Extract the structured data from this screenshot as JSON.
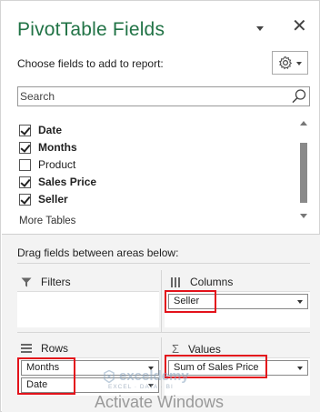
{
  "header": {
    "title": "PivotTable Fields",
    "subtitle": "Choose fields to add to report:"
  },
  "search": {
    "placeholder": "Search"
  },
  "fields": [
    {
      "label": "Date",
      "checked": true,
      "bold": true
    },
    {
      "label": "Months",
      "checked": true,
      "bold": true
    },
    {
      "label": "Product",
      "checked": false,
      "bold": false
    },
    {
      "label": "Sales Price",
      "checked": true,
      "bold": true
    },
    {
      "label": "Seller",
      "checked": true,
      "bold": true
    }
  ],
  "more_tables_label": "More Tables",
  "areas": {
    "drag_label": "Drag fields between areas below:",
    "filters": {
      "label": "Filters",
      "items": []
    },
    "columns": {
      "label": "Columns",
      "items": [
        "Seller"
      ]
    },
    "rows": {
      "label": "Rows",
      "items": [
        "Months",
        "Date"
      ]
    },
    "values": {
      "label": "Values",
      "items": [
        "Sum of Sales Price"
      ]
    }
  },
  "watermark": {
    "brand": "exceldemy",
    "tagline": "EXCEL · DATA · BI",
    "activate_text": "Activate Windows"
  },
  "colors": {
    "title_green": "#217346",
    "highlight_red": "#e3121b"
  }
}
